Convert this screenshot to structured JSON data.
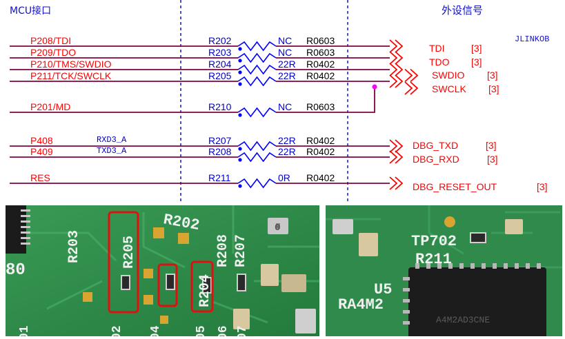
{
  "header": {
    "mcu_title": "MCU接口",
    "ext_title": "外设信号",
    "jlink_label": "JLINKOB"
  },
  "nets": [
    {
      "mcu": "P208/TDI",
      "ref": "R202",
      "value": "NC",
      "pkg": "R0603",
      "out": "TDI",
      "out_ref": "[3]"
    },
    {
      "mcu": "P209/TDO",
      "ref": "R203",
      "value": "NC",
      "pkg": "R0603",
      "out": "TDO",
      "out_ref": "[3]"
    },
    {
      "mcu": "P210/TMS/SWDIO",
      "ref": "R204",
      "value": "22R",
      "pkg": "R0402",
      "out": "SWDIO",
      "out_ref": "[3]"
    },
    {
      "mcu": "P211/TCK/SWCLK",
      "ref": "R205",
      "value": "22R",
      "pkg": "R0402",
      "out": "SWCLK",
      "out_ref": "[3]"
    },
    {
      "mcu": "P201/MD",
      "ref": "R210",
      "value": "NC",
      "pkg": "R0603"
    },
    {
      "mcu": "P408",
      "alt": "RXD3_A",
      "ref": "R207",
      "value": "22R",
      "pkg": "R0402",
      "out": "DBG_TXD",
      "out_ref": "[3]"
    },
    {
      "mcu": "P409",
      "alt": "TXD3_A",
      "ref": "R208",
      "value": "22R",
      "pkg": "R0402",
      "out": "DBG_RXD",
      "out_ref": "[3]"
    },
    {
      "mcu": "RES",
      "ref": "R211",
      "value": "0R",
      "pkg": "R0402",
      "out": "DBG_RESET_OUT",
      "out_ref": "[3]"
    }
  ],
  "photo_left": {
    "silk": [
      "R202",
      "R203",
      "R205",
      "R204",
      "R208",
      "R207",
      "80",
      "02",
      "04",
      "05",
      "06",
      "07",
      "01",
      "0"
    ]
  },
  "photo_right": {
    "silk": [
      "TP702",
      "R211",
      "U5",
      "RA4M2",
      "A4M2AD3CNE"
    ]
  },
  "colors": {
    "wire": "#800040",
    "label": "#ff0000",
    "blue": "#0000cc",
    "dot": "#0000ff",
    "junction": "#ff00ff",
    "highlight": "#e01010"
  }
}
